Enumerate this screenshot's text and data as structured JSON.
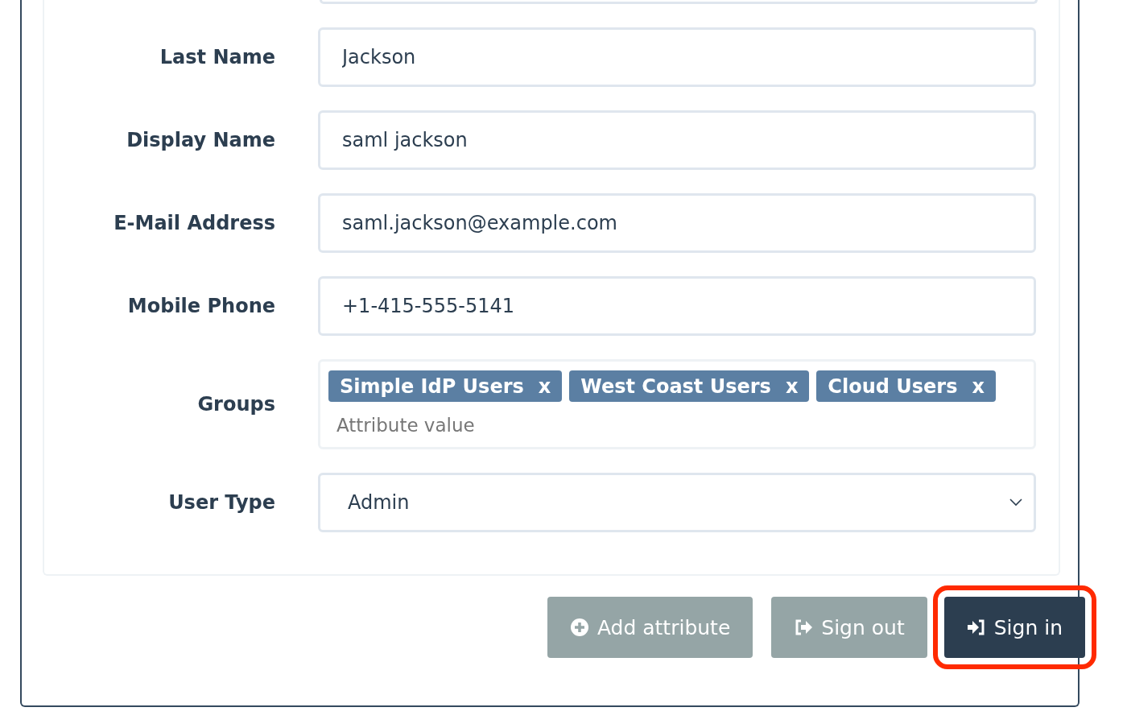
{
  "fields": [
    {
      "kind": "text",
      "label": "Last Name",
      "value": "Jackson"
    },
    {
      "kind": "text",
      "label": "Display Name",
      "value": "saml jackson"
    },
    {
      "kind": "text",
      "label": "E-Mail Address",
      "value": "saml.jackson@example.com"
    },
    {
      "kind": "text",
      "label": "Mobile Phone",
      "value": "+1-415-555-5141"
    },
    {
      "kind": "tags",
      "label": "Groups",
      "tags": [
        {
          "text": "Simple IdP Users",
          "remove": "x"
        },
        {
          "text": "West Coast Users",
          "remove": "x"
        },
        {
          "text": "Cloud Users",
          "remove": "x"
        }
      ],
      "placeholder": "Attribute value"
    },
    {
      "kind": "select",
      "label": "User Type",
      "value": "Admin"
    }
  ],
  "buttons": [
    {
      "kind": "add",
      "label": "Add attribute",
      "primary": false,
      "highlighted": false
    },
    {
      "kind": "sign-out",
      "label": "Sign out",
      "primary": false,
      "highlighted": false
    },
    {
      "kind": "sign-in",
      "label": "Sign in",
      "primary": true,
      "highlighted": true
    }
  ]
}
